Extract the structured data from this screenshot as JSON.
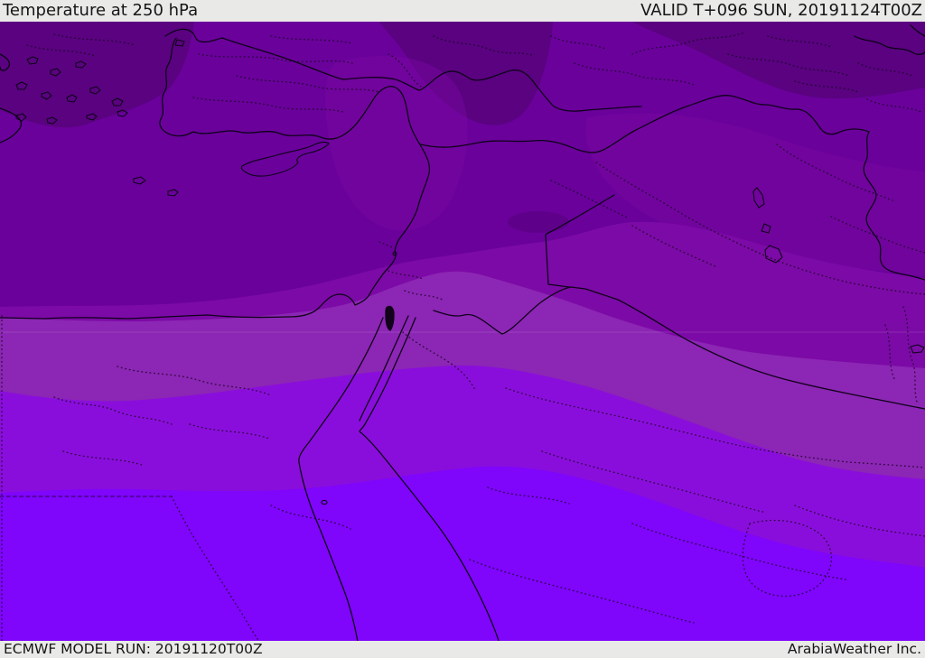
{
  "header": {
    "title": "Temperature at 250 hPa",
    "valid": "VALID T+096 SUN, 20191124T00Z"
  },
  "footer": {
    "model_run": "ECMWF MODEL RUN: 20191120T00Z",
    "brand": "ArabiaWeather Inc."
  },
  "map": {
    "description": "Filled temperature shading over the Eastern Mediterranean / Middle East",
    "colors": {
      "darkest": "#5a0280",
      "dark": "#6a019b",
      "dark_patch": "#76089f",
      "medium": "#7c0aa6",
      "light": "#8c26b4",
      "bright": "#8a0edb",
      "brightest": "#7f05fb",
      "border": "#0e0118",
      "admin": "#1a0526",
      "bar_bg": "#e9e9e8",
      "bar_text": "#161616"
    }
  }
}
